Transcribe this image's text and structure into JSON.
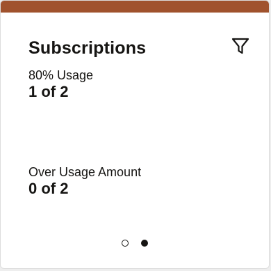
{
  "card": {
    "title": "Subscriptions",
    "accent_color": "#a0522d",
    "filter_icon": "filter-icon"
  },
  "metrics": [
    {
      "label": "80% Usage",
      "value": "1 of 2"
    },
    {
      "label": "Over Usage Amount",
      "value": "0 of 2"
    }
  ],
  "pager": {
    "total_pages": 2,
    "active_page": 2
  }
}
